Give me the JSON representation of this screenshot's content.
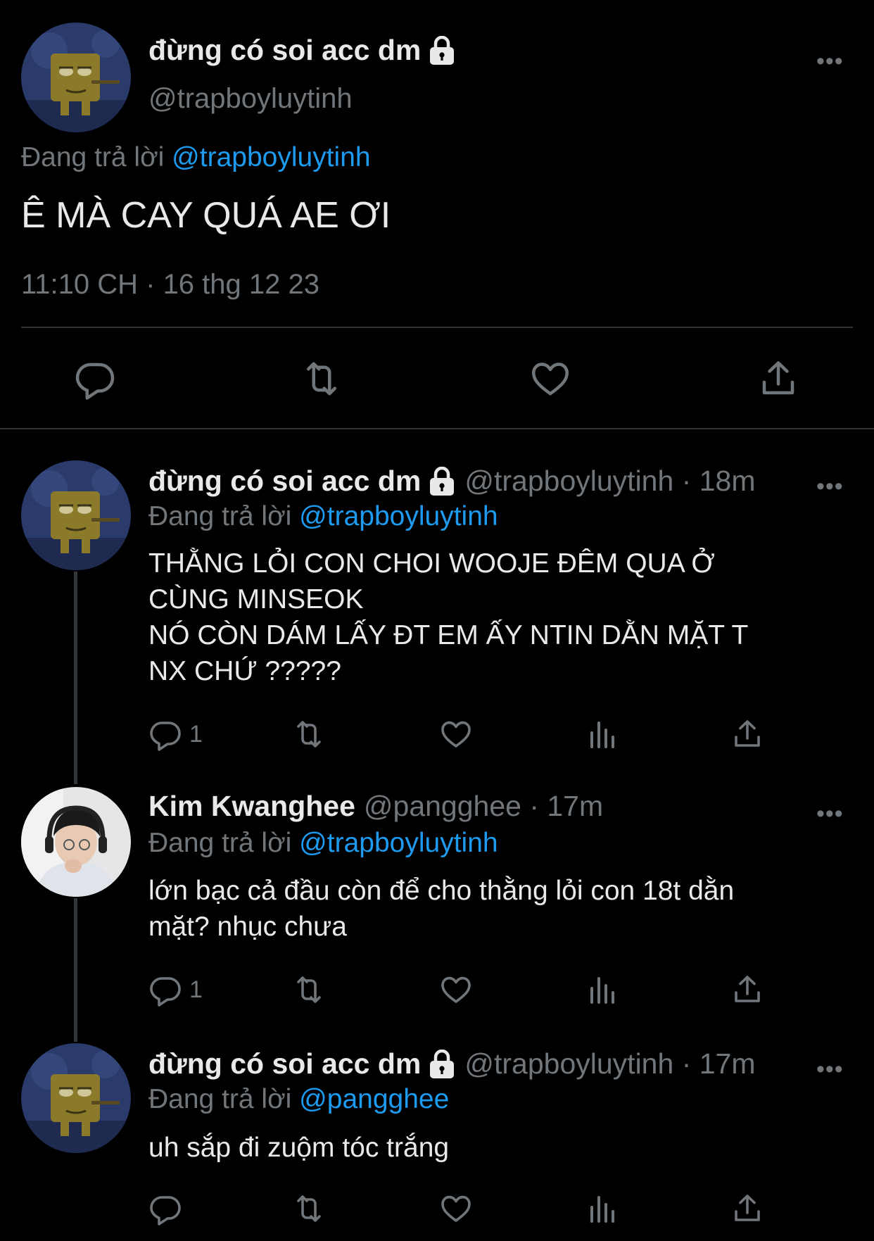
{
  "main_tweet": {
    "display_name": "đừng có soi acc dm",
    "handle": "@trapboyluytinh",
    "replying_prefix": "Đang trả lời",
    "replying_to": "@trapboyluytinh",
    "text": "Ê MÀ CAY QUÁ AE ƠI",
    "timestamp": "11:10 CH · 16 thg 12 23",
    "more": "•••",
    "icons": [
      "reply-icon",
      "retweet-icon",
      "like-icon",
      "share-icon"
    ]
  },
  "replies": [
    {
      "display_name": "đừng có soi acc dm",
      "handle_time": "@trapboyluytinh · 18m",
      "replying_prefix": "Đang trả lời",
      "replying_to": "@trapboyluytinh",
      "lines": [
        "THẰNG LỎI CON CHOI WOOJE ĐÊM QUA Ở",
        "CÙNG MINSEOK",
        "NÓ CÒN DÁM LẤY ĐT EM ẤY NTIN DẰN MẶT T",
        "NX CHỨ ?????"
      ],
      "reply_count": "1",
      "more": "•••"
    },
    {
      "display_name": "Kim Kwanghee",
      "handle_time": "@pangghee · 17m",
      "replying_prefix": "Đang trả lời",
      "replying_to": "@trapboyluytinh",
      "lines": [
        "lớn bạc cả đầu còn để cho thằng lỏi con 18t dằn",
        "mặt? nhục chưa"
      ],
      "reply_count": "1",
      "more": "•••"
    },
    {
      "display_name": "đừng có soi acc dm",
      "handle_time": "@trapboyluytinh · 17m",
      "replying_prefix": "Đang trả lời",
      "replying_to": "@pangghee",
      "lines": [
        "uh sắp đi zuộm tóc trắng"
      ],
      "reply_count": "",
      "more": "•••"
    }
  ],
  "colors": {
    "background": "#000000",
    "text": "#e7e9ea",
    "muted": "#71767b",
    "link": "#1d9bf0",
    "divider": "#2f3336"
  }
}
